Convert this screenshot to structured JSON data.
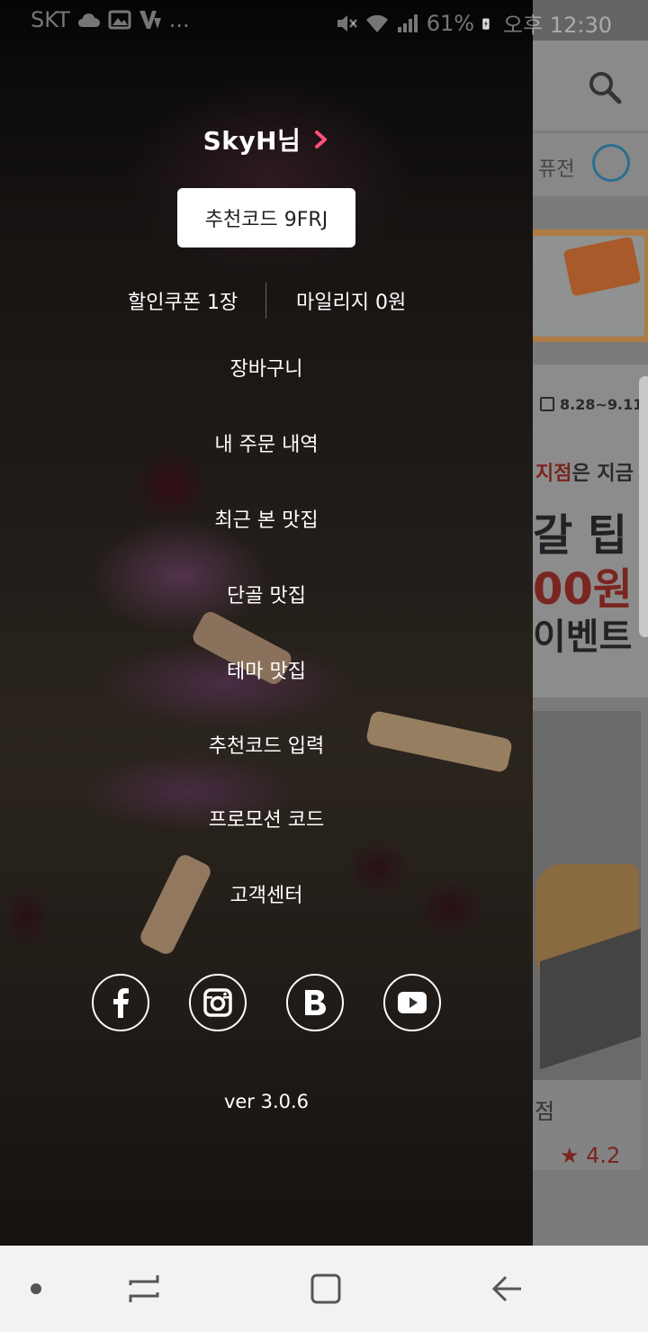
{
  "status_bar": {
    "carrier": "SKT",
    "more": "...",
    "battery": "61%",
    "time": "오후 12:30"
  },
  "background": {
    "tab_label": "퓨전",
    "event_date": "8.28~9.11",
    "event_line1_accent": "지점",
    "event_line1_rest": "은 지금",
    "event_line2": "갈 팁",
    "event_line3": "00원",
    "event_line4": "이벤트",
    "card_name": "점",
    "card_rating": "★ 4.2"
  },
  "drawer": {
    "user_name": "SkyH님",
    "referral_code": "추천코드 9FRJ",
    "coupon": "할인쿠폰 1장",
    "mileage": "마일리지 0원",
    "menu": [
      {
        "label": "장바구니"
      },
      {
        "label": "내 주문 내역"
      },
      {
        "label": "최근 본 맛집"
      },
      {
        "label": "단골 맛집"
      },
      {
        "label": "테마 맛집"
      },
      {
        "label": "추천코드 입력"
      },
      {
        "label": "프로모션 코드"
      },
      {
        "label": "고객센터"
      }
    ],
    "social": [
      {
        "icon": "facebook-icon"
      },
      {
        "icon": "instagram-icon"
      },
      {
        "icon": "blog-icon"
      },
      {
        "icon": "youtube-icon"
      }
    ],
    "version": "ver 3.0.6"
  },
  "colors": {
    "accent_chevron": "#ff4f7a",
    "nav_bar": "#f2f2f2"
  }
}
